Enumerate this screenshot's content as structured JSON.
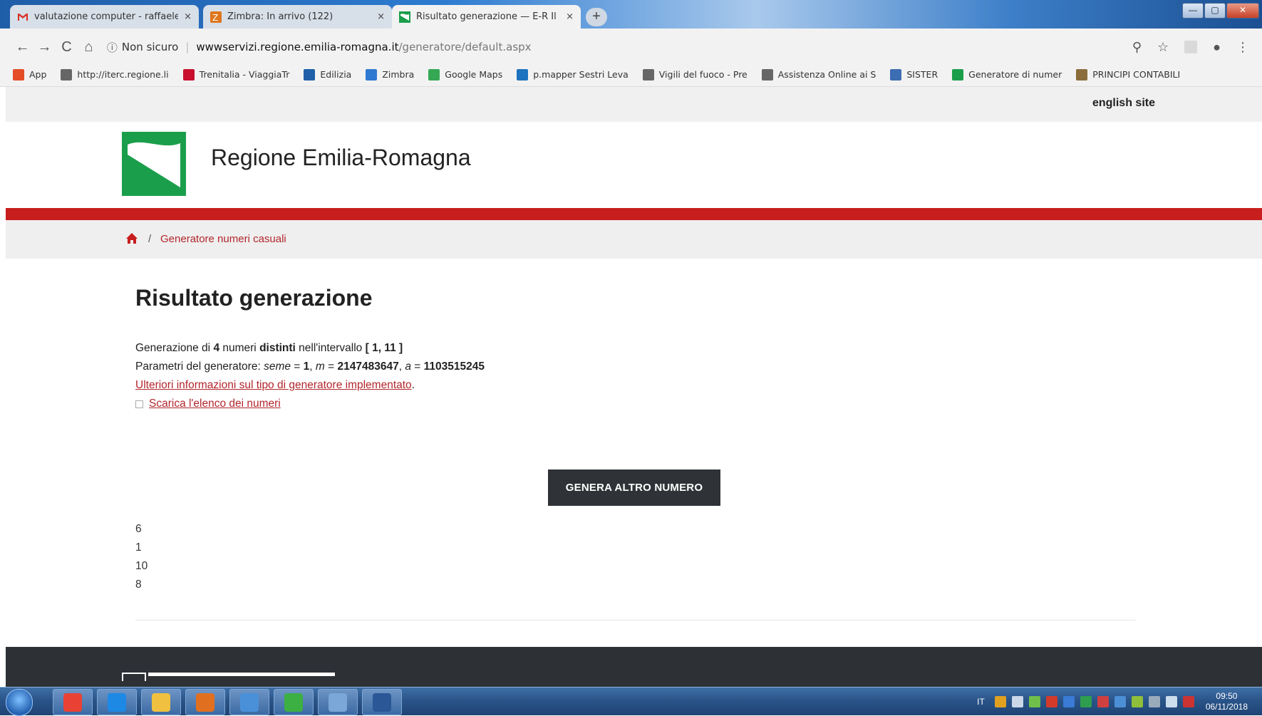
{
  "browser": {
    "tabs": [
      {
        "title": "valutazione computer - raffaeler",
        "icon": "gmail-icon"
      },
      {
        "title": "Zimbra: In arrivo (122)",
        "icon": "zimbra-icon"
      },
      {
        "title": "Risultato generazione — E-R Il p",
        "icon": "emilia-romagna-icon"
      }
    ],
    "new_tab_label": "+",
    "tab_close_label": "×",
    "window_controls": {
      "minimize": "—",
      "maximize": "▢",
      "close": "✕"
    },
    "nav": {
      "back": "←",
      "forward": "→",
      "reload": "C",
      "home": "⌂"
    },
    "address": {
      "security_label": "Non sicuro",
      "domain": "wwwservizi.regione.emilia-romagna.it",
      "path": "/generatore/default.aspx"
    },
    "addr_right": {
      "zoom": "⚲",
      "star": "☆",
      "account": "●",
      "menu": "⋮"
    },
    "bookmarks": [
      {
        "label": "App",
        "icon": "apps-grid-icon",
        "color": "#e44d26"
      },
      {
        "label": "http://iterc.regione.li",
        "icon": "page-icon",
        "color": "#666666"
      },
      {
        "label": "Trenitalia - ViaggiaTr",
        "icon": "trenitalia-icon",
        "color": "#c8102e"
      },
      {
        "label": "Edilizia",
        "icon": "calculator-icon",
        "color": "#1f5fa8"
      },
      {
        "label": "Zimbra",
        "icon": "zimbra-icon",
        "color": "#2f79d0"
      },
      {
        "label": "Google Maps",
        "icon": "maps-icon",
        "color": "#34a853"
      },
      {
        "label": "p.mapper Sestri Leva",
        "icon": "pmapper-icon",
        "color": "#1e73be"
      },
      {
        "label": "Vigili del fuoco - Pre",
        "icon": "page-icon",
        "color": "#666666"
      },
      {
        "label": "Assistenza Online ai S",
        "icon": "page-icon",
        "color": "#666666"
      },
      {
        "label": "SISTER",
        "icon": "sister-icon",
        "color": "#3d6db3"
      },
      {
        "label": "Generatore di numer",
        "icon": "emilia-romagna-icon",
        "color": "#1b9e4b"
      },
      {
        "label": "PRINCIPI CONTABILI",
        "icon": "mef-icon",
        "color": "#8a6d3b"
      }
    ]
  },
  "site": {
    "english_link": "english site",
    "title": "Regione Emilia-Romagna",
    "brand_green": "#1b9e4b",
    "brand_red": "#c81e1e",
    "breadcrumb": {
      "separator": "/",
      "current": "Generatore numeri casuali"
    }
  },
  "result": {
    "heading": "Risultato generazione",
    "line1": {
      "p1": "Generazione di ",
      "count": "4",
      "p2": " numeri ",
      "distinct": "distinti",
      "p3": " nell'intervallo ",
      "range": "[ 1, 11 ]"
    },
    "line2": {
      "p1": "Parametri del generatore: ",
      "seed_label": "seme",
      "eq1": " = ",
      "seed": "1",
      "sep1": ", ",
      "m_label": "m",
      "eq2": " = ",
      "m": "2147483647",
      "sep2": ", ",
      "a_label": "a",
      "eq3": " = ",
      "a": "1103515245"
    },
    "more_info_link": "Ulteriori informazioni sul tipo di generatore implementato",
    "more_info_suffix": ".",
    "download_link": "Scarica l'elenco dei numeri",
    "generate_button": "GENERA ALTRO NUMERO",
    "numbers": [
      "6",
      "1",
      "10",
      "8"
    ]
  },
  "taskbar": {
    "apps": [
      "chrome-icon",
      "internet-explorer-icon",
      "file-explorer-icon",
      "media-player-icon",
      "thunderbird-icon",
      "green-arrow-icon",
      "network-app-icon",
      "word-icon"
    ],
    "language": "IT",
    "time": "09:50",
    "date": "06/11/2018"
  }
}
